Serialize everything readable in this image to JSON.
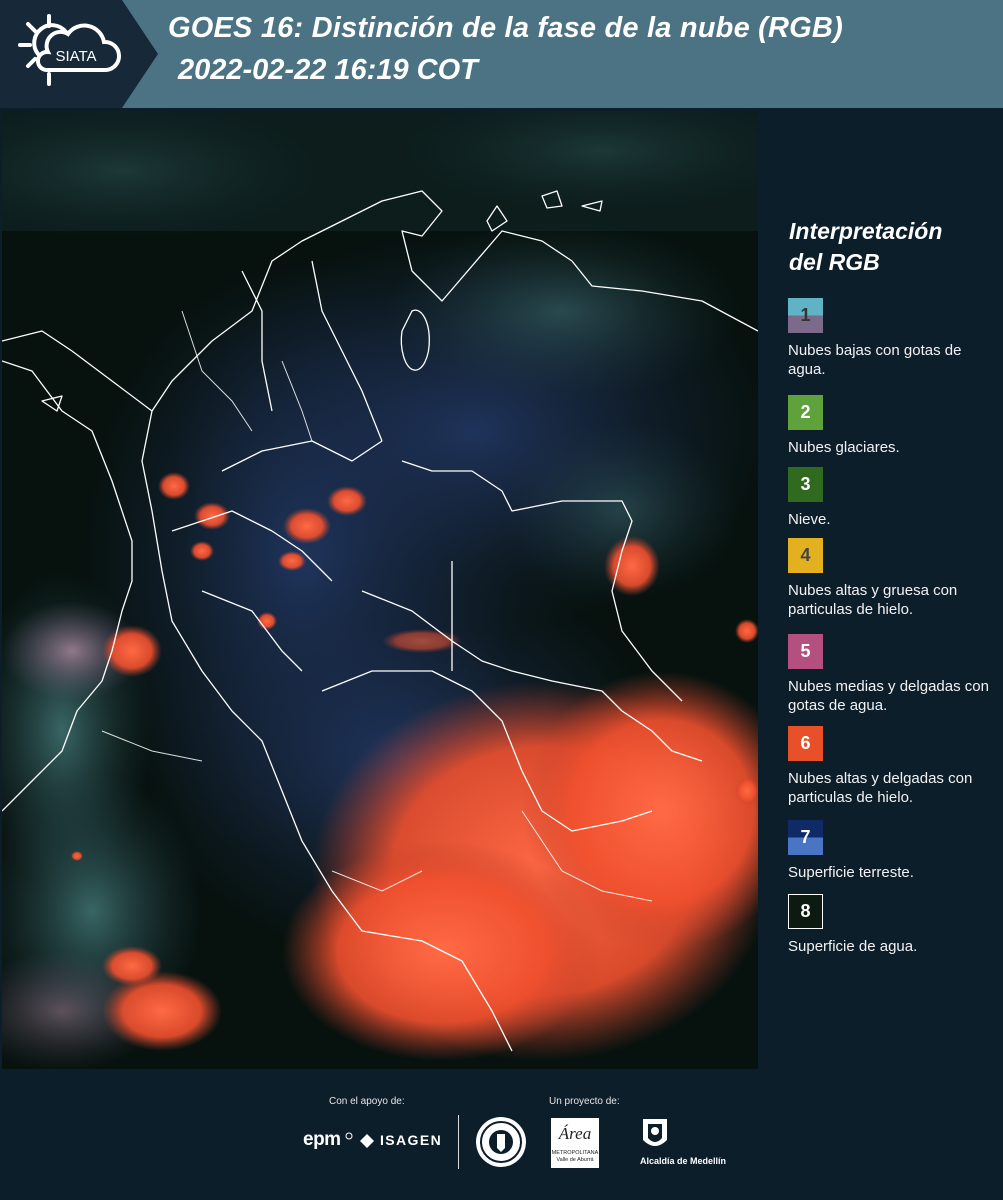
{
  "header": {
    "logo_text": "SIATA",
    "title_line1": "GOES 16: Distinción de la fase de la nube (RGB)",
    "title_line2": "2022-02-22 16:19 COT"
  },
  "legend": {
    "title_line1": "Interpretación",
    "title_line2": "del RGB",
    "items": [
      {
        "number": "1",
        "label": "Nubes bajas con gotas de agua.",
        "color_top": "#5fb3c4",
        "color_bottom": "#7c6a8a",
        "text_color": "#333333"
      },
      {
        "number": "2",
        "label": "Nubes glaciares.",
        "color": "#5fa13a",
        "text_color": "#ffffff"
      },
      {
        "number": "3",
        "label": "Nieve.",
        "color": "#2f6a1e",
        "text_color": "#ffffff"
      },
      {
        "number": "4",
        "label": "Nubes altas y gruesa con particulas de hielo.",
        "color": "#e3b020",
        "text_color": "#444444"
      },
      {
        "number": "5",
        "label": "Nubes medias y delgadas con gotas de agua.",
        "color": "#b3507f",
        "text_color": "#ffffff"
      },
      {
        "number": "6",
        "label": "Nubes altas y delgadas con particulas de hielo.",
        "color": "#e8502a",
        "text_color": "#ffffff"
      },
      {
        "number": "7",
        "label": "Superficie terreste.",
        "color_top": "#0f2a66",
        "color_bottom": "#4a74c4",
        "text_color": "#ffffff"
      },
      {
        "number": "8",
        "label": "Superficie de agua.",
        "color": "#0d1a10",
        "text_color": "#ffffff",
        "border": "#ffffff"
      }
    ]
  },
  "footer": {
    "support_label": "Con el apoyo de:",
    "project_label": "Un proyecto de:",
    "epm": "epm",
    "isagen": "ISAGEN",
    "area_title": "Área",
    "area_sub": "METROPOLITANA Valle de Aburrá",
    "alcaldia": "Alcaldía de Medellín"
  }
}
